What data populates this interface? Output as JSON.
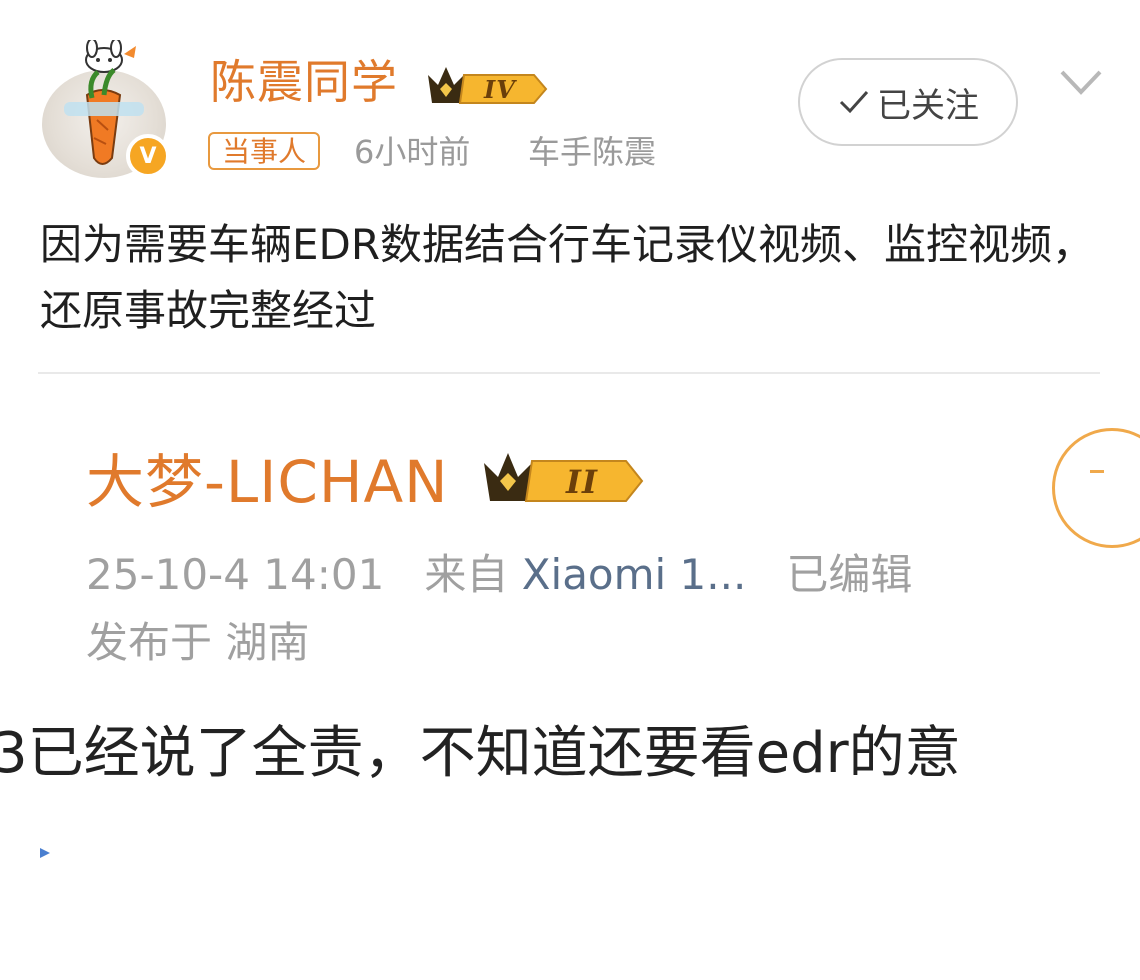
{
  "post": {
    "username": "陈震同学",
    "level_badge": "IV",
    "tag": "当事人",
    "time": "6小时前",
    "source": "车手陈震",
    "verified_badge": "V",
    "follow_label": "已关注",
    "text": "因为需要车辆EDR数据结合行车记录仪视频、监控视频，还原事故完整经过"
  },
  "quoted": {
    "username": "大梦-LICHAN",
    "level_badge": "II",
    "date": "25-10-4 14:01",
    "from_label": "来自",
    "device": "Xiaomi 1...",
    "edited": "已编辑",
    "location": "发布于 湖南",
    "text": "3已经说了全责，不知道还要看edr的意"
  },
  "colors": {
    "accent_orange": "#e07a2c",
    "meta_gray": "#9a9a9a",
    "badge_gold": "#f6a623"
  },
  "icons": [
    "avatar-image",
    "crown-level-icon",
    "verified-icon",
    "checkmark-icon",
    "chevron-down-icon"
  ]
}
